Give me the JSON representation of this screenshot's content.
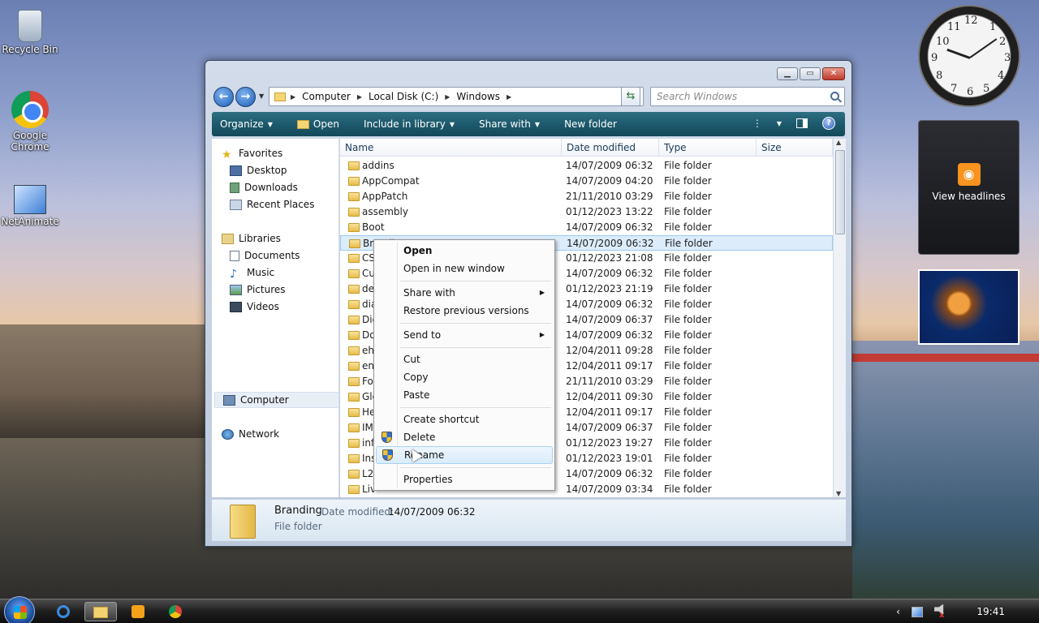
{
  "desktop": {
    "icons": [
      {
        "label": "Recycle Bin"
      },
      {
        "label": "Google Chrome"
      },
      {
        "label": "NetAnimate"
      }
    ],
    "feed_gadget": {
      "label": "View headlines"
    },
    "clock_numbers": [
      "12",
      "1",
      "2",
      "3",
      "4",
      "5",
      "6",
      "7",
      "8",
      "9",
      "10",
      "11"
    ]
  },
  "window": {
    "breadcrumb": [
      "Computer",
      "Local Disk (C:)",
      "Windows"
    ],
    "search_placeholder": "Search Windows",
    "toolbar": {
      "organize": "Organize",
      "open": "Open",
      "include": "Include in library",
      "share": "Share with",
      "new_folder": "New folder"
    },
    "nav": {
      "favorites": "Favorites",
      "desktop": "Desktop",
      "downloads": "Downloads",
      "recent": "Recent Places",
      "libraries": "Libraries",
      "documents": "Documents",
      "music": "Music",
      "pictures": "Pictures",
      "videos": "Videos",
      "computer": "Computer",
      "network": "Network"
    },
    "columns": {
      "name": "Name",
      "date": "Date modified",
      "type": "Type",
      "size": "Size"
    },
    "files": [
      {
        "name": "addins",
        "date": "14/07/2009 06:32",
        "type": "File folder"
      },
      {
        "name": "AppCompat",
        "date": "14/07/2009 04:20",
        "type": "File folder"
      },
      {
        "name": "AppPatch",
        "date": "21/11/2010 03:29",
        "type": "File folder"
      },
      {
        "name": "assembly",
        "date": "01/12/2023 13:22",
        "type": "File folder"
      },
      {
        "name": "Boot",
        "date": "14/07/2009 06:32",
        "type": "File folder"
      },
      {
        "name": "Brandi",
        "date": "14/07/2009 06:32",
        "type": "File folder"
      },
      {
        "name": "CS",
        "date": "01/12/2023 21:08",
        "type": "File folder"
      },
      {
        "name": "Cu",
        "date": "14/07/2009 06:32",
        "type": "File folder"
      },
      {
        "name": "de",
        "date": "01/12/2023 21:19",
        "type": "File folder"
      },
      {
        "name": "dia",
        "date": "14/07/2009 06:32",
        "type": "File folder"
      },
      {
        "name": "Dig",
        "date": "14/07/2009 06:37",
        "type": "File folder"
      },
      {
        "name": "Do",
        "date": "14/07/2009 06:32",
        "type": "File folder"
      },
      {
        "name": "eh",
        "date": "12/04/2011 09:28",
        "type": "File folder"
      },
      {
        "name": "en-",
        "date": "12/04/2011 09:17",
        "type": "File folder"
      },
      {
        "name": "Fo",
        "date": "21/11/2010 03:29",
        "type": "File folder"
      },
      {
        "name": "Glo",
        "date": "12/04/2011 09:30",
        "type": "File folder"
      },
      {
        "name": "He",
        "date": "12/04/2011 09:17",
        "type": "File folder"
      },
      {
        "name": "IM",
        "date": "14/07/2009 06:37",
        "type": "File folder"
      },
      {
        "name": "inf",
        "date": "01/12/2023 19:27",
        "type": "File folder"
      },
      {
        "name": "Ins",
        "date": "01/12/2023 19:01",
        "type": "File folder"
      },
      {
        "name": "L2S",
        "date": "14/07/2009 06:32",
        "type": "File folder"
      },
      {
        "name": "Liv",
        "date": "14/07/2009 03:34",
        "type": "File folder"
      }
    ],
    "details": {
      "name": "Branding",
      "date_label": "Date modified:",
      "date": "14/07/2009 06:32",
      "type": "File folder"
    }
  },
  "context_menu": {
    "items": {
      "open": "Open",
      "open_new": "Open in new window",
      "share": "Share with",
      "restore": "Restore previous versions",
      "send_to": "Send to",
      "cut": "Cut",
      "copy": "Copy",
      "paste": "Paste",
      "shortcut": "Create shortcut",
      "delete": "Delete",
      "rename": "Rename",
      "properties": "Properties"
    }
  },
  "taskbar": {
    "time": "19:41"
  }
}
